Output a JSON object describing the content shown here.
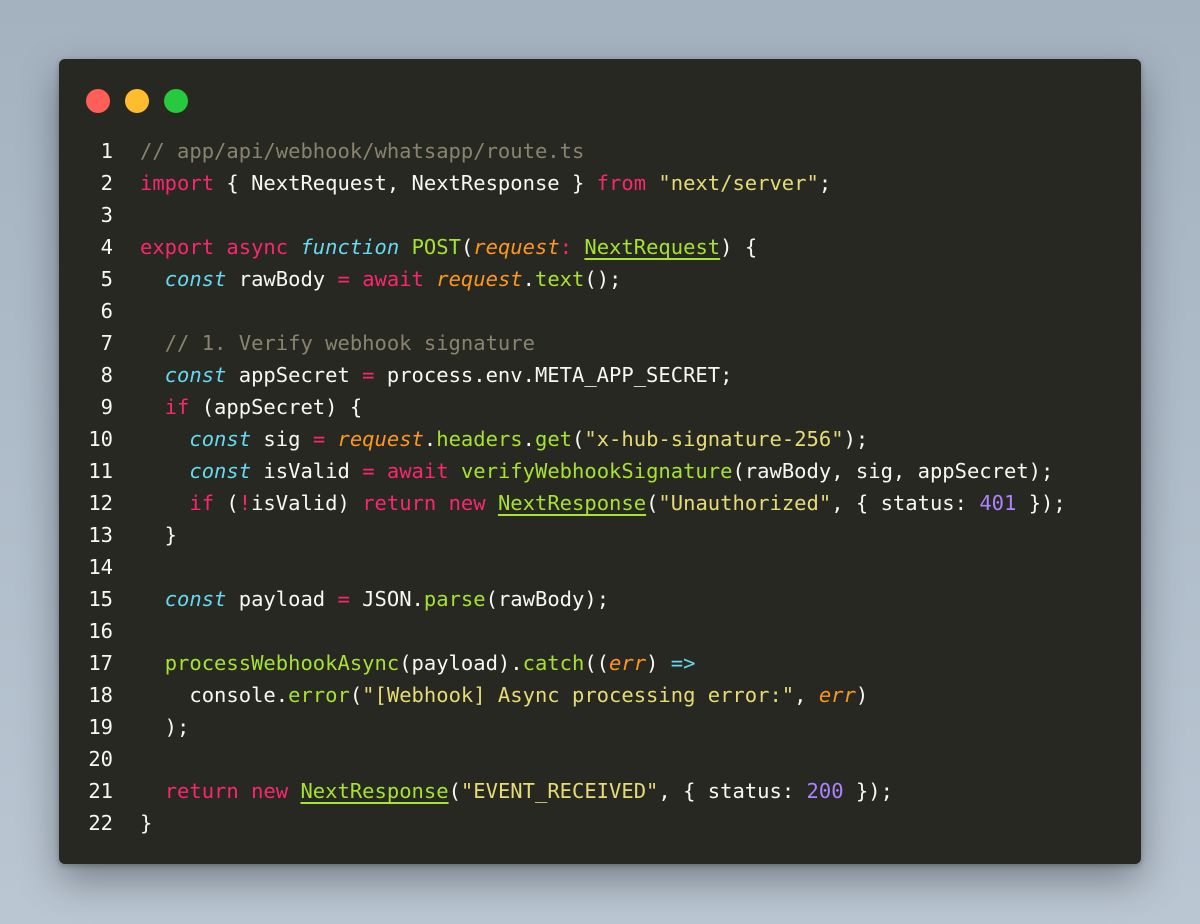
{
  "window": {
    "controls": [
      "close",
      "minimize",
      "maximize"
    ],
    "colors": {
      "background": "#272822",
      "close": "#ff5f56",
      "minimize": "#ffbd2e",
      "maximize": "#27c93f"
    }
  },
  "code": {
    "language": "typescript",
    "lines": [
      {
        "n": "1",
        "tokens": [
          {
            "t": "// app/api/webhook/whatsapp/route.ts",
            "c": "cm"
          }
        ]
      },
      {
        "n": "2",
        "tokens": [
          {
            "t": "import",
            "c": "kw"
          },
          {
            "t": " { NextRequest, NextResponse } ",
            "c": "plain"
          },
          {
            "t": "from",
            "c": "kw"
          },
          {
            "t": " ",
            "c": "plain"
          },
          {
            "t": "\"next/server\"",
            "c": "st"
          },
          {
            "t": ";",
            "c": "plain"
          }
        ]
      },
      {
        "n": "3",
        "tokens": []
      },
      {
        "n": "4",
        "tokens": [
          {
            "t": "export",
            "c": "kw"
          },
          {
            "t": " ",
            "c": "plain"
          },
          {
            "t": "async",
            "c": "kw"
          },
          {
            "t": " ",
            "c": "plain"
          },
          {
            "t": "function",
            "c": "st-kw"
          },
          {
            "t": " ",
            "c": "plain"
          },
          {
            "t": "POST",
            "c": "fn"
          },
          {
            "t": "(",
            "c": "plain"
          },
          {
            "t": "request",
            "c": "par"
          },
          {
            "t": ": ",
            "c": "kw"
          },
          {
            "t": "NextRequest",
            "c": "cls"
          },
          {
            "t": ") {",
            "c": "plain"
          }
        ]
      },
      {
        "n": "5",
        "tokens": [
          {
            "t": "  ",
            "c": "plain"
          },
          {
            "t": "const",
            "c": "st-kw"
          },
          {
            "t": " rawBody ",
            "c": "plain"
          },
          {
            "t": "=",
            "c": "op"
          },
          {
            "t": " ",
            "c": "plain"
          },
          {
            "t": "await",
            "c": "kw"
          },
          {
            "t": " ",
            "c": "plain"
          },
          {
            "t": "request",
            "c": "par"
          },
          {
            "t": ".",
            "c": "plain"
          },
          {
            "t": "text",
            "c": "fn"
          },
          {
            "t": "();",
            "c": "plain"
          }
        ]
      },
      {
        "n": "6",
        "tokens": []
      },
      {
        "n": "7",
        "tokens": [
          {
            "t": "  ",
            "c": "plain"
          },
          {
            "t": "// 1. Verify webhook signature",
            "c": "cm"
          }
        ]
      },
      {
        "n": "8",
        "tokens": [
          {
            "t": "  ",
            "c": "plain"
          },
          {
            "t": "const",
            "c": "st-kw"
          },
          {
            "t": " appSecret ",
            "c": "plain"
          },
          {
            "t": "=",
            "c": "op"
          },
          {
            "t": " process.env.META_APP_SECRET;",
            "c": "plain"
          }
        ]
      },
      {
        "n": "9",
        "tokens": [
          {
            "t": "  ",
            "c": "plain"
          },
          {
            "t": "if",
            "c": "kw"
          },
          {
            "t": " (appSecret) {",
            "c": "plain"
          }
        ]
      },
      {
        "n": "10",
        "tokens": [
          {
            "t": "    ",
            "c": "plain"
          },
          {
            "t": "const",
            "c": "st-kw"
          },
          {
            "t": " sig ",
            "c": "plain"
          },
          {
            "t": "=",
            "c": "op"
          },
          {
            "t": " ",
            "c": "plain"
          },
          {
            "t": "request",
            "c": "par"
          },
          {
            "t": ".",
            "c": "plain"
          },
          {
            "t": "headers",
            "c": "fn"
          },
          {
            "t": ".",
            "c": "plain"
          },
          {
            "t": "get",
            "c": "fn"
          },
          {
            "t": "(",
            "c": "plain"
          },
          {
            "t": "\"x-hub-signature-256\"",
            "c": "st"
          },
          {
            "t": ");",
            "c": "plain"
          }
        ]
      },
      {
        "n": "11",
        "tokens": [
          {
            "t": "    ",
            "c": "plain"
          },
          {
            "t": "const",
            "c": "st-kw"
          },
          {
            "t": " isValid ",
            "c": "plain"
          },
          {
            "t": "=",
            "c": "op"
          },
          {
            "t": " ",
            "c": "plain"
          },
          {
            "t": "await",
            "c": "kw"
          },
          {
            "t": " ",
            "c": "plain"
          },
          {
            "t": "verifyWebhookSignature",
            "c": "fn"
          },
          {
            "t": "(rawBody, sig, appSecret);",
            "c": "plain"
          }
        ]
      },
      {
        "n": "12",
        "tokens": [
          {
            "t": "    ",
            "c": "plain"
          },
          {
            "t": "if",
            "c": "kw"
          },
          {
            "t": " (",
            "c": "plain"
          },
          {
            "t": "!",
            "c": "op"
          },
          {
            "t": "isValid) ",
            "c": "plain"
          },
          {
            "t": "return",
            "c": "kw"
          },
          {
            "t": " ",
            "c": "plain"
          },
          {
            "t": "new",
            "c": "kw"
          },
          {
            "t": " ",
            "c": "plain"
          },
          {
            "t": "NextResponse",
            "c": "cls"
          },
          {
            "t": "(",
            "c": "plain"
          },
          {
            "t": "\"Unauthorized\"",
            "c": "st"
          },
          {
            "t": ", { status: ",
            "c": "plain"
          },
          {
            "t": "401",
            "c": "num"
          },
          {
            "t": " });",
            "c": "plain"
          }
        ]
      },
      {
        "n": "13",
        "tokens": [
          {
            "t": "  }",
            "c": "plain"
          }
        ]
      },
      {
        "n": "14",
        "tokens": []
      },
      {
        "n": "15",
        "tokens": [
          {
            "t": "  ",
            "c": "plain"
          },
          {
            "t": "const",
            "c": "st-kw"
          },
          {
            "t": " payload ",
            "c": "plain"
          },
          {
            "t": "=",
            "c": "op"
          },
          {
            "t": " JSON.",
            "c": "plain"
          },
          {
            "t": "parse",
            "c": "fn"
          },
          {
            "t": "(rawBody);",
            "c": "plain"
          }
        ]
      },
      {
        "n": "16",
        "tokens": []
      },
      {
        "n": "17",
        "tokens": [
          {
            "t": "  ",
            "c": "plain"
          },
          {
            "t": "processWebhookAsync",
            "c": "fn"
          },
          {
            "t": "(payload).",
            "c": "plain"
          },
          {
            "t": "catch",
            "c": "fn"
          },
          {
            "t": "((",
            "c": "plain"
          },
          {
            "t": "err",
            "c": "par"
          },
          {
            "t": ") ",
            "c": "plain"
          },
          {
            "t": "=>",
            "c": "arrow"
          }
        ]
      },
      {
        "n": "18",
        "tokens": [
          {
            "t": "    console.",
            "c": "plain"
          },
          {
            "t": "error",
            "c": "fn"
          },
          {
            "t": "(",
            "c": "plain"
          },
          {
            "t": "\"[Webhook] Async processing error:\"",
            "c": "st"
          },
          {
            "t": ", ",
            "c": "plain"
          },
          {
            "t": "err",
            "c": "par"
          },
          {
            "t": ")",
            "c": "plain"
          }
        ]
      },
      {
        "n": "19",
        "tokens": [
          {
            "t": "  );",
            "c": "plain"
          }
        ]
      },
      {
        "n": "20",
        "tokens": []
      },
      {
        "n": "21",
        "tokens": [
          {
            "t": "  ",
            "c": "plain"
          },
          {
            "t": "return",
            "c": "kw"
          },
          {
            "t": " ",
            "c": "plain"
          },
          {
            "t": "new",
            "c": "kw"
          },
          {
            "t": " ",
            "c": "plain"
          },
          {
            "t": "NextResponse",
            "c": "cls"
          },
          {
            "t": "(",
            "c": "plain"
          },
          {
            "t": "\"EVENT_RECEIVED\"",
            "c": "st"
          },
          {
            "t": ", { status: ",
            "c": "plain"
          },
          {
            "t": "200",
            "c": "num"
          },
          {
            "t": " });",
            "c": "plain"
          }
        ]
      },
      {
        "n": "22",
        "tokens": [
          {
            "t": "}",
            "c": "plain"
          }
        ]
      }
    ]
  }
}
